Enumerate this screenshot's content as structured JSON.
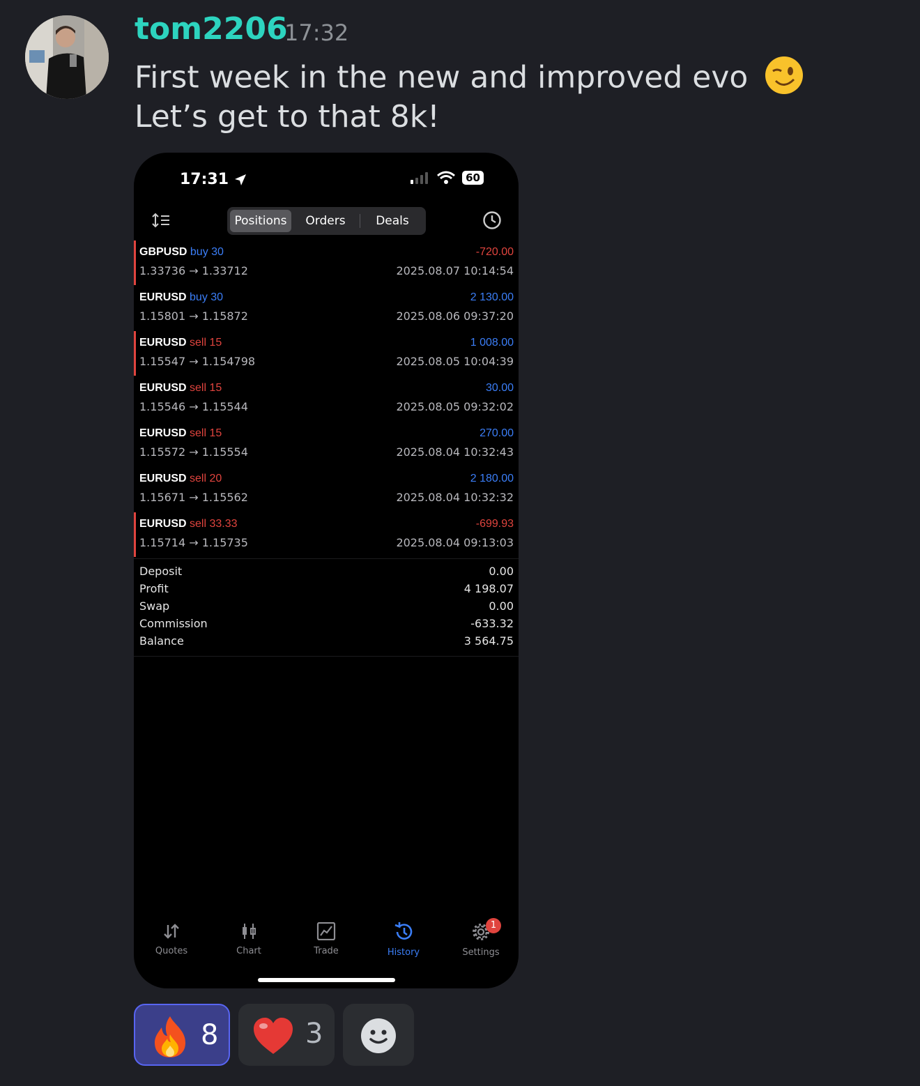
{
  "message": {
    "username": "tom2206",
    "timestamp": "17:32",
    "line1": "First week in the new and improved evo",
    "line2": "Let’s get to that 8k!",
    "emoji": "winking-face"
  },
  "phone": {
    "status": {
      "time": "17:31",
      "battery": "60"
    },
    "tabs": {
      "positions": "Positions",
      "orders": "Orders",
      "deals": "Deals",
      "active": "Positions"
    },
    "deals": [
      {
        "symbol": "GBPUSD",
        "side": "buy",
        "volume": "30",
        "open": "1.33736",
        "close": "1.33712",
        "profit": "-720.00",
        "time": "2025.08.07 10:14:54"
      },
      {
        "symbol": "EURUSD",
        "side": "buy",
        "volume": "30",
        "open": "1.15801",
        "close": "1.15872",
        "profit": "2 130.00",
        "time": "2025.08.06 09:37:20"
      },
      {
        "symbol": "EURUSD",
        "side": "sell",
        "volume": "15",
        "open": "1.15547",
        "close": "1.154798",
        "profit": "1 008.00",
        "time": "2025.08.05 10:04:39"
      },
      {
        "symbol": "EURUSD",
        "side": "sell",
        "volume": "15",
        "open": "1.15546",
        "close": "1.15544",
        "profit": "30.00",
        "time": "2025.08.05 09:32:02"
      },
      {
        "symbol": "EURUSD",
        "side": "sell",
        "volume": "15",
        "open": "1.15572",
        "close": "1.15554",
        "profit": "270.00",
        "time": "2025.08.04 10:32:43"
      },
      {
        "symbol": "EURUSD",
        "side": "sell",
        "volume": "20",
        "open": "1.15671",
        "close": "1.15562",
        "profit": "2 180.00",
        "time": "2025.08.04 10:32:32"
      },
      {
        "symbol": "EURUSD",
        "side": "sell",
        "volume": "33.33",
        "open": "1.15714",
        "close": "1.15735",
        "profit": "-699.93",
        "time": "2025.08.04 09:13:03"
      }
    ],
    "summary": {
      "deposit_label": "Deposit",
      "deposit": "0.00",
      "profit_label": "Profit",
      "profit": "4 198.07",
      "swap_label": "Swap",
      "swap": "0.00",
      "commission_label": "Commission",
      "commission": "-633.32",
      "balance_label": "Balance",
      "balance": "3 564.75"
    },
    "tabbar": {
      "quotes": "Quotes",
      "chart": "Chart",
      "trade": "Trade",
      "history": "History",
      "settings": "Settings",
      "active": "History",
      "settings_badge": "1"
    }
  },
  "reactions": [
    {
      "emoji": "fire",
      "count": "8",
      "selected": true
    },
    {
      "emoji": "red-heart",
      "count": "3",
      "selected": false
    },
    {
      "emoji": "add-reaction",
      "count": "",
      "selected": false
    }
  ],
  "colors": {
    "username": "#2dd4bf",
    "buy": "#3b7ef7",
    "sell": "#e0443e",
    "background": "#1e1f25"
  }
}
